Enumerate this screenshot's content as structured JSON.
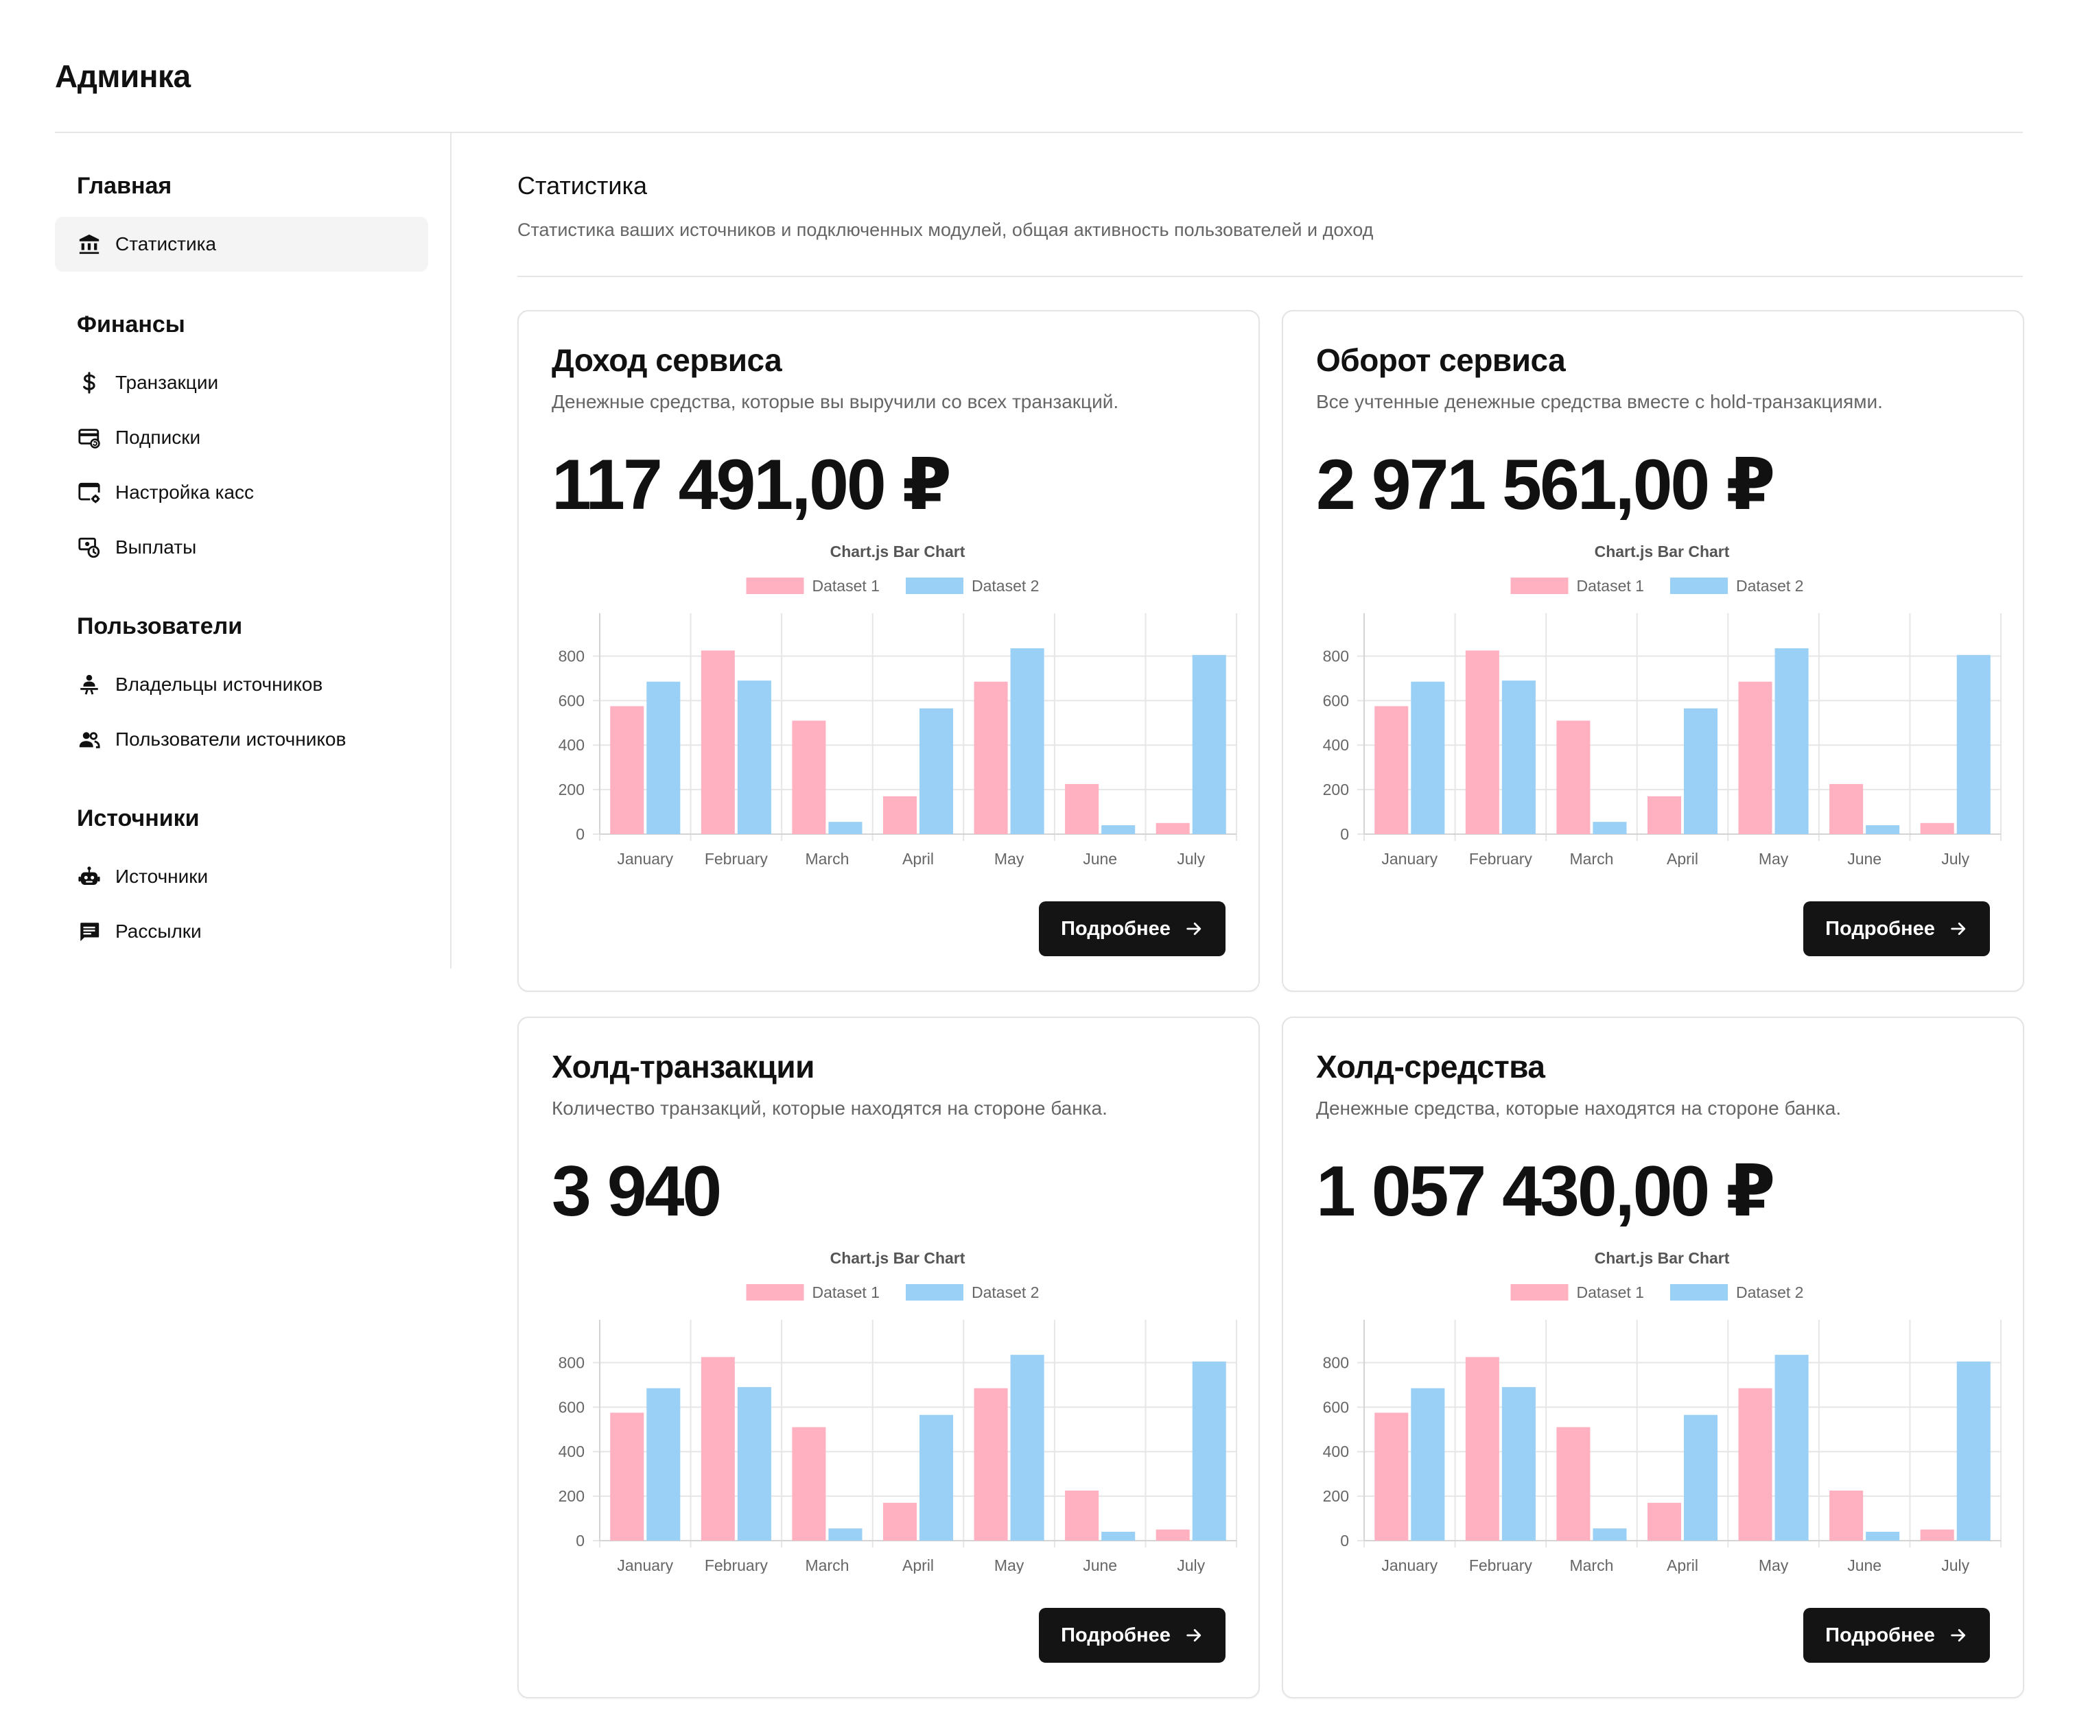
{
  "app": {
    "title": "Админка"
  },
  "sidebar": {
    "sections": [
      {
        "title": "Главная",
        "items": [
          {
            "label": "Статистика",
            "icon": "bank-icon",
            "active": true
          }
        ]
      },
      {
        "title": "Финансы",
        "items": [
          {
            "label": "Транзакции",
            "icon": "dollar-icon"
          },
          {
            "label": "Подписки",
            "icon": "subscription-card-icon"
          },
          {
            "label": "Настройка касс",
            "icon": "cashbox-settings-icon"
          },
          {
            "label": "Выплаты",
            "icon": "payout-clock-icon"
          }
        ]
      },
      {
        "title": "Пользователи",
        "items": [
          {
            "label": "Владельцы источников",
            "icon": "owner-icon"
          },
          {
            "label": "Пользователи источников",
            "icon": "users-icon"
          }
        ]
      },
      {
        "title": "Источники",
        "items": [
          {
            "label": "Источники",
            "icon": "robot-icon"
          },
          {
            "label": "Рассылки",
            "icon": "message-icon"
          }
        ]
      }
    ]
  },
  "main": {
    "title": "Статистика",
    "description": "Статистика ваших источников и подключенных модулей, общая активность пользователей и доход"
  },
  "cards": [
    {
      "title": "Доход сервиса",
      "description": "Денежные средства, которые вы выручили со всех транзакций.",
      "value": "117 491,00 ₽",
      "button_label": "Подробнее"
    },
    {
      "title": "Оборот сервиса",
      "description": "Все учтенные денежные средства вместе с hold-транзакциями.",
      "value": "2 971 561,00 ₽",
      "button_label": "Подробнее"
    },
    {
      "title": "Холд-транзакции",
      "description": "Количество транзакций, которые находятся на стороне банка.",
      "value": "3 940",
      "button_label": "Подробнее"
    },
    {
      "title": "Холд-средства",
      "description": "Денежные средства, которые находятся на стороне банка.",
      "value": "1 057 430,00 ₽",
      "button_label": "Подробнее"
    }
  ],
  "chart_data": {
    "type": "bar",
    "title": "Chart.js Bar Chart",
    "categories": [
      "January",
      "February",
      "March",
      "April",
      "May",
      "June",
      "July"
    ],
    "series": [
      {
        "name": "Dataset 1",
        "values": [
          575,
          825,
          510,
          170,
          685,
          225,
          50
        ],
        "color": "#ffb1c1"
      },
      {
        "name": "Dataset 2",
        "values": [
          685,
          690,
          55,
          565,
          835,
          40,
          805
        ],
        "color": "#9ad0f5"
      }
    ],
    "yticks": [
      0,
      200,
      400,
      600,
      800
    ],
    "ylim": [
      0,
      900
    ],
    "legend": "top",
    "grid": true
  },
  "colors": {
    "button_bg": "#141414",
    "active_nav_bg": "#f4f4f5",
    "border": "#e4e4e7"
  }
}
